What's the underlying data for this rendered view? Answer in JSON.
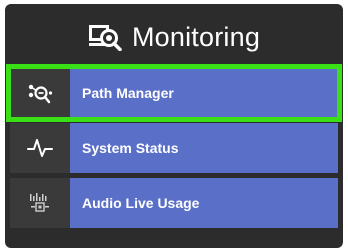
{
  "header": {
    "title": "Monitoring",
    "icon": "monitoring-search-icon"
  },
  "menu": {
    "items": [
      {
        "label": "Path Manager",
        "icon": "path-manager-icon",
        "selected": true
      },
      {
        "label": "System Status",
        "icon": "pulse-icon",
        "selected": false
      },
      {
        "label": "Audio Live Usage",
        "icon": "audio-usage-icon",
        "selected": false
      }
    ]
  },
  "colors": {
    "panel_bg": "#2c2c2c",
    "item_bg": "#5a6fc8",
    "icon_cell_bg": "#3a3a3a",
    "selection_outline": "#39e015",
    "text": "#ffffff"
  }
}
